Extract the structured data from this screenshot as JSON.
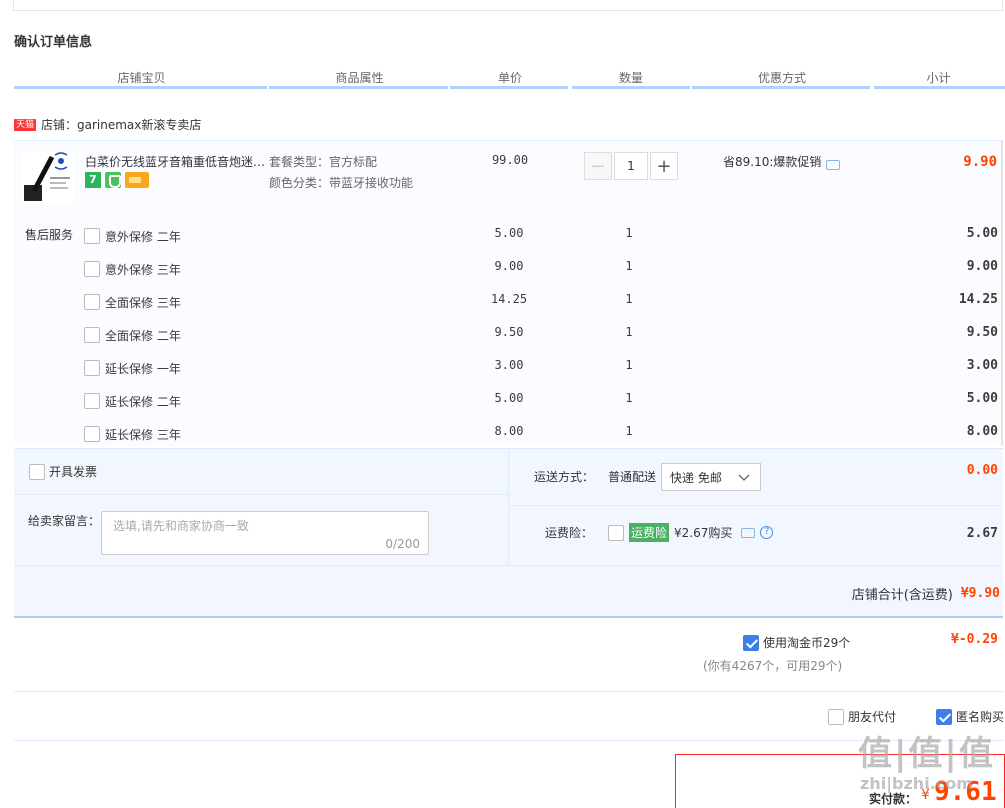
{
  "section_title": "确认订单信息",
  "columns": [
    "店铺宝贝",
    "商品属性",
    "单价",
    "数量",
    "优惠方式",
    "小计"
  ],
  "shop": {
    "badge": "天猫",
    "label": "店铺：garinemax新滚专卖店"
  },
  "product": {
    "title": "白菜价无线蓝牙音箱重低音炮迷你…",
    "badges": [
      "7"
    ],
    "attr_package": "套餐类型：官方标配",
    "attr_color": "颜色分类：带蓝牙接收功能",
    "price": "99.00",
    "quantity": "1",
    "discount": "省89.10:爆款促销",
    "subtotal": "9.90"
  },
  "after_sales": {
    "label": "售后服务",
    "items": [
      {
        "name": "意外保修 二年",
        "price": "5.00",
        "qty": "1",
        "subtotal": "5.00"
      },
      {
        "name": "意外保修 三年",
        "price": "9.00",
        "qty": "1",
        "subtotal": "9.00"
      },
      {
        "name": "全面保修 三年",
        "price": "14.25",
        "qty": "1",
        "subtotal": "14.25"
      },
      {
        "name": "全面保修 二年",
        "price": "9.50",
        "qty": "1",
        "subtotal": "9.50"
      },
      {
        "name": "延长保修 一年",
        "price": "3.00",
        "qty": "1",
        "subtotal": "3.00"
      },
      {
        "name": "延长保修 二年",
        "price": "5.00",
        "qty": "1",
        "subtotal": "5.00"
      },
      {
        "name": "延长保修 三年",
        "price": "8.00",
        "qty": "1",
        "subtotal": "8.00"
      }
    ]
  },
  "invoice_label": "开具发票",
  "message": {
    "label": "给卖家留言：",
    "placeholder": "选填,请先和商家协商一致",
    "counter": "0/200"
  },
  "shipping": {
    "label": "运送方式：",
    "method": "普通配送",
    "selected": "快递 免邮",
    "cost": "0.00"
  },
  "freight_insurance": {
    "label": "运费险：",
    "tag": "运费险",
    "text": "¥2.67购买",
    "cost": "2.67"
  },
  "shop_total": {
    "label": "店铺合计(含运费)",
    "value": "¥9.90"
  },
  "coins": {
    "label": "使用淘金币29个",
    "note": "(你有4267个，可用29个)",
    "value": "¥-0.29"
  },
  "options": {
    "friend_pay": "朋友代付",
    "anonymous": "匿名购买"
  },
  "final": {
    "label": "实付款：",
    "currency": "¥",
    "amount": "9.61"
  },
  "watermark": "值|值|值",
  "watermark_url": "zhi|bzhi.com",
  "colors": {
    "accent": "#f40",
    "header_bar": "#b2d1ff",
    "checkbox": "#3d7fe8",
    "panel": "#fbfcff"
  }
}
